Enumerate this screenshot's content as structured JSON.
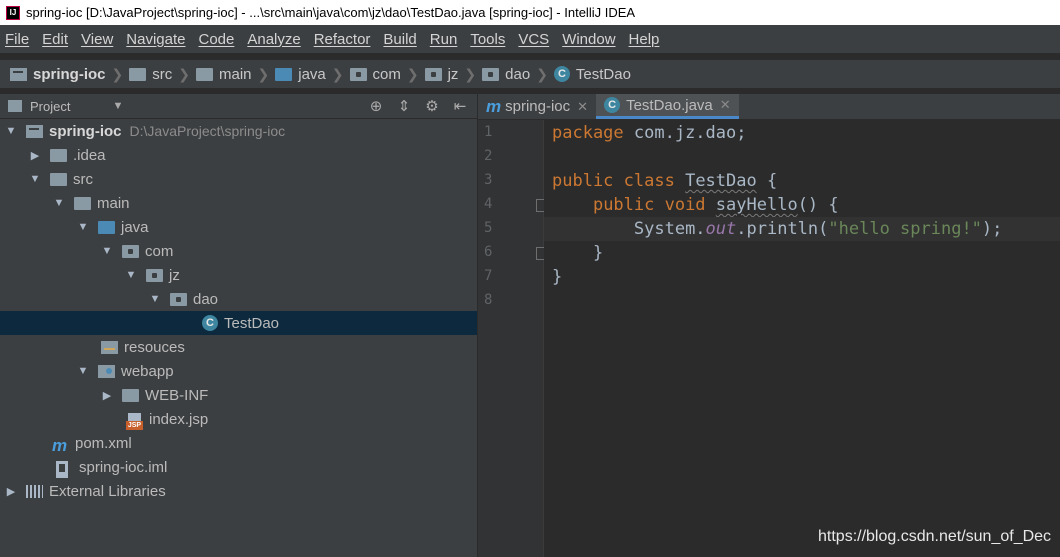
{
  "window": {
    "title": "spring-ioc [D:\\JavaProject\\spring-ioc] - ...\\src\\main\\java\\com\\jz\\dao\\TestDao.java [spring-ioc] - IntelliJ IDEA"
  },
  "menu": [
    "File",
    "Edit",
    "View",
    "Navigate",
    "Code",
    "Analyze",
    "Refactor",
    "Build",
    "Run",
    "Tools",
    "VCS",
    "Window",
    "Help"
  ],
  "breadcrumbs": [
    "spring-ioc",
    "src",
    "main",
    "java",
    "com",
    "jz",
    "dao",
    "TestDao"
  ],
  "project_panel": {
    "title": "Project",
    "tree": [
      {
        "label": "spring-ioc",
        "path": "D:\\JavaProject\\spring-ioc"
      },
      {
        "label": ".idea"
      },
      {
        "label": "src"
      },
      {
        "label": "main"
      },
      {
        "label": "java"
      },
      {
        "label": "com"
      },
      {
        "label": "jz"
      },
      {
        "label": "dao"
      },
      {
        "label": "TestDao"
      },
      {
        "label": "resouces"
      },
      {
        "label": "webapp"
      },
      {
        "label": "WEB-INF"
      },
      {
        "label": "index.jsp"
      },
      {
        "label": "pom.xml"
      },
      {
        "label": "spring-ioc.iml"
      },
      {
        "label": "External Libraries"
      }
    ]
  },
  "editor": {
    "tabs": [
      {
        "label": "spring-ioc",
        "active": false
      },
      {
        "label": "TestDao.java",
        "active": true
      }
    ],
    "line_numbers": [
      "1",
      "2",
      "3",
      "4",
      "5",
      "6",
      "7",
      "8"
    ],
    "code": {
      "l1_kw": "package",
      "l1_rest": " com.jz.dao;",
      "l3_kw": "public class",
      "l3_name": "TestDao",
      "l3_rest": " {",
      "l4_kw": "public void",
      "l4_name": "sayHello",
      "l4_rest": "() {",
      "l5_a": "System.",
      "l5_field": "out",
      "l5_b": ".println(",
      "l5_str": "\"hello spring!\"",
      "l5_c": ");",
      "l6": "}",
      "l7": "}"
    }
  },
  "watermark": "https://blog.csdn.net/sun_of_Dec"
}
